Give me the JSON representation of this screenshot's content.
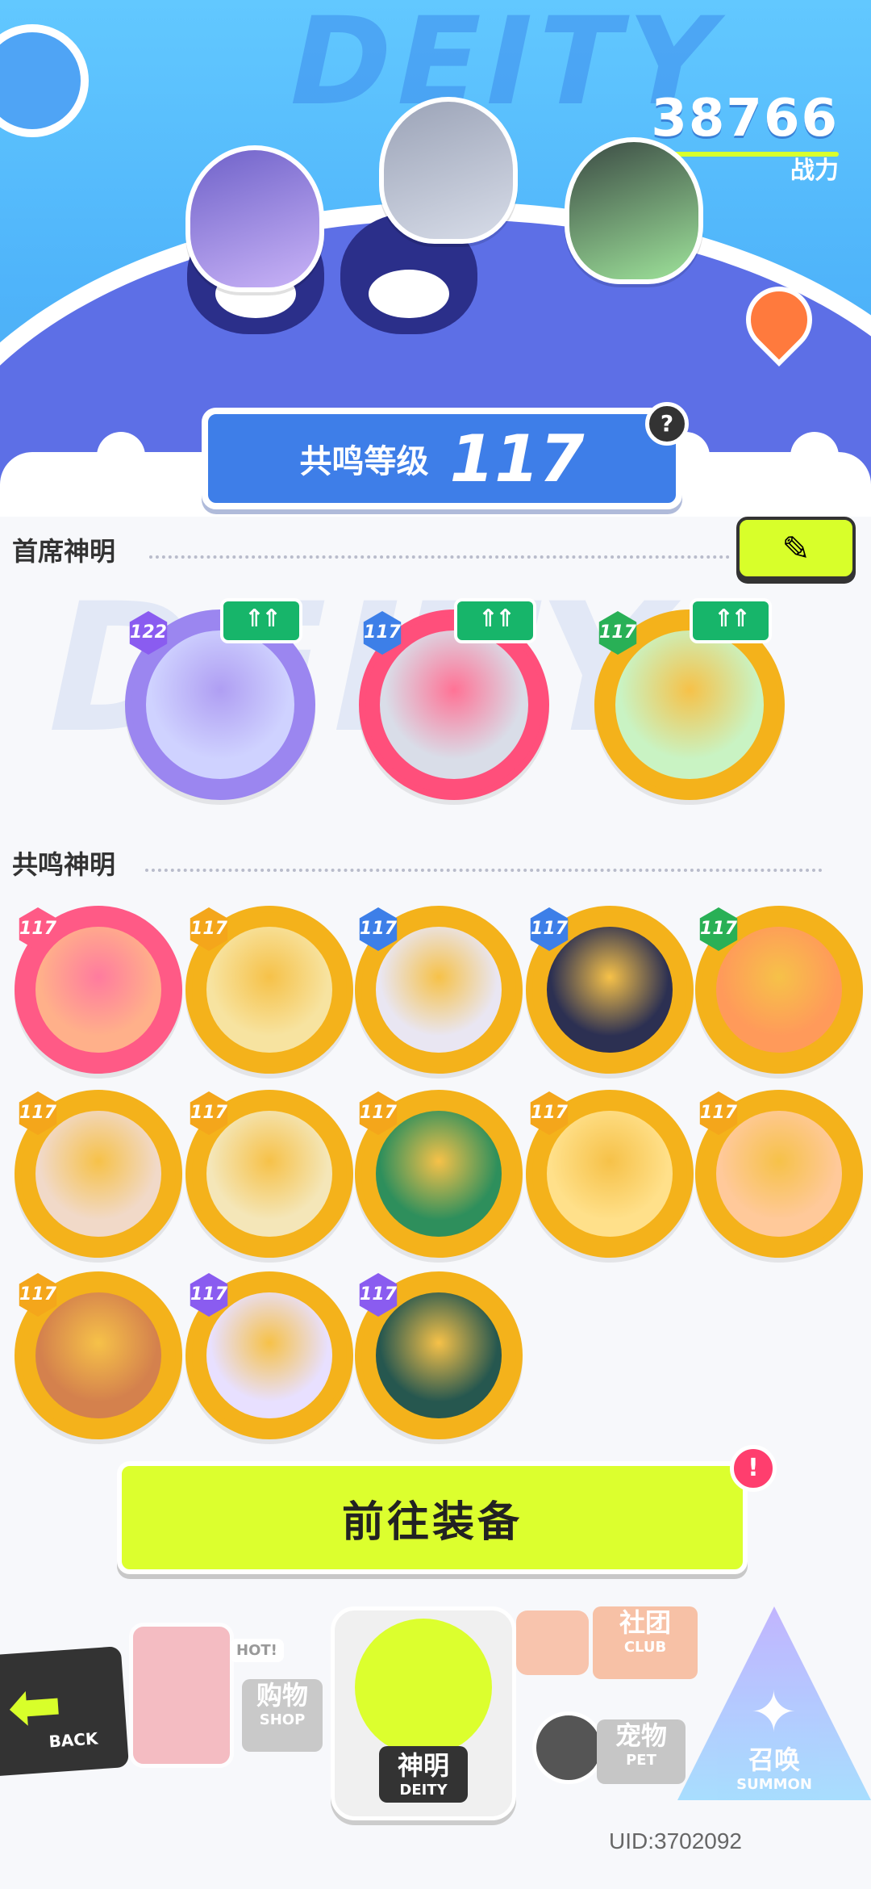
{
  "header": {
    "bg_word": "DEITY",
    "power_value": "38766",
    "power_label": "战力",
    "resonance_label": "共鸣等级",
    "resonance_level": "117",
    "help_icon": "?"
  },
  "chief": {
    "title": "首席神明",
    "edit_icon": "✎",
    "cards": [
      {
        "level": "122",
        "up": "⇑⇑",
        "frame": "#9b86f0",
        "badge": "#8a5cf0",
        "face": "#cfd2ff"
      },
      {
        "level": "117",
        "up": "⇑⇑",
        "frame": "#ff4f7b",
        "badge": "#3d7fe8",
        "face": "#d9dde8"
      },
      {
        "level": "117",
        "up": "⇑⇑",
        "frame": "#f4b21b",
        "badge": "#29b056",
        "face": "#c9f3c3"
      }
    ]
  },
  "resonance": {
    "title": "共鸣神明",
    "cards": [
      {
        "level": "117",
        "frame": "#ff5a86",
        "badge": "#ff5a86",
        "face": "#ffb08a"
      },
      {
        "level": "117",
        "frame": "#f4b21b",
        "badge": "#f4a61b",
        "face": "#f7e3a0"
      },
      {
        "level": "117",
        "frame": "#f4b21b",
        "badge": "#3d7fe8",
        "face": "#e9e6f2"
      },
      {
        "level": "117",
        "frame": "#f4b21b",
        "badge": "#3d7fe8",
        "face": "#2c3052"
      },
      {
        "level": "117",
        "frame": "#f4b21b",
        "badge": "#29b056",
        "face": "#ff9a5a"
      },
      {
        "level": "117",
        "frame": "#f4b21b",
        "badge": "#f4a61b",
        "face": "#f1d9c8"
      },
      {
        "level": "117",
        "frame": "#f4b21b",
        "badge": "#f4a61b",
        "face": "#f4e6b8"
      },
      {
        "level": "117",
        "frame": "#f4b21b",
        "badge": "#f4a61b",
        "face": "#2e8f5c"
      },
      {
        "level": "117",
        "frame": "#f4b21b",
        "badge": "#f4a61b",
        "face": "#ffe08a"
      },
      {
        "level": "117",
        "frame": "#f4b21b",
        "badge": "#f4a61b",
        "face": "#ffc99a"
      },
      {
        "level": "117",
        "frame": "#f4b21b",
        "badge": "#f4a61b",
        "face": "#d4814d"
      },
      {
        "level": "117",
        "frame": "#f4b21b",
        "badge": "#8a5cf0",
        "face": "#e8e0ff"
      },
      {
        "level": "117",
        "frame": "#f4b21b",
        "badge": "#8a5cf0",
        "face": "#26574f"
      }
    ]
  },
  "actions": {
    "equip": "前往装备",
    "alert": "!"
  },
  "nav": {
    "back": "BACK",
    "back_icon": "⬅",
    "shop_hot": "HOT!",
    "shop_zh": "购物",
    "shop_en": "SHOP",
    "deity_zh": "神明",
    "deity_en": "DEITY",
    "club_zh": "社团",
    "club_en": "CLUB",
    "pet_zh": "宠物",
    "pet_en": "PET",
    "summon_zh": "召唤",
    "summon_en": "SUMMON",
    "summon_icon": "✦"
  },
  "uid": "UID:3702092"
}
